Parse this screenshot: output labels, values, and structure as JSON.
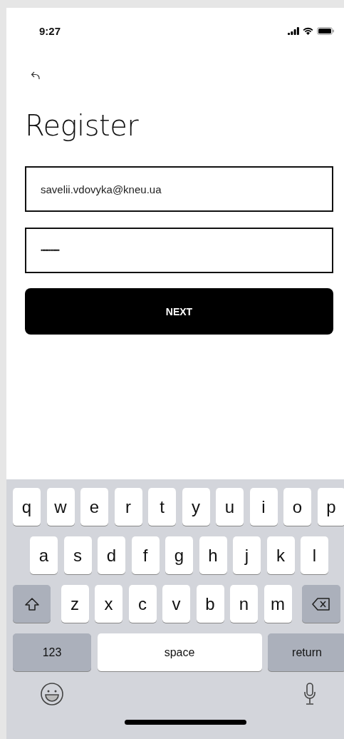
{
  "status_bar": {
    "time": "9:27"
  },
  "title": "Register",
  "fields": [
    {
      "kind": "email",
      "value": "savelii.vdovyka@kneu.ua"
    },
    {
      "kind": "password",
      "value": "••••••••••••"
    }
  ],
  "next_button": {
    "label": "NEXT"
  },
  "keyboard": {
    "key_rows": [
      {
        "keys": [
          {
            "kind": "letter",
            "label": "q"
          },
          {
            "kind": "letter",
            "label": "w"
          },
          {
            "kind": "letter",
            "label": "e"
          },
          {
            "kind": "letter",
            "label": "r"
          },
          {
            "kind": "letter",
            "label": "t"
          },
          {
            "kind": "letter",
            "label": "y"
          },
          {
            "kind": "letter",
            "label": "u"
          },
          {
            "kind": "letter",
            "label": "i"
          },
          {
            "kind": "letter",
            "label": "o"
          },
          {
            "kind": "letter",
            "label": "p"
          }
        ]
      },
      {
        "keys": [
          {
            "kind": "letter",
            "label": "a"
          },
          {
            "kind": "letter",
            "label": "s"
          },
          {
            "kind": "letter",
            "label": "d"
          },
          {
            "kind": "letter",
            "label": "f"
          },
          {
            "kind": "letter",
            "label": "g"
          },
          {
            "kind": "letter",
            "label": "h"
          },
          {
            "kind": "letter",
            "label": "j"
          },
          {
            "kind": "letter",
            "label": "k"
          },
          {
            "kind": "letter",
            "label": "l"
          }
        ]
      },
      {
        "keys": [
          {
            "kind": "shift"
          },
          {
            "kind": "letter",
            "label": "z"
          },
          {
            "kind": "letter",
            "label": "x"
          },
          {
            "kind": "letter",
            "label": "c"
          },
          {
            "kind": "letter",
            "label": "v"
          },
          {
            "kind": "letter",
            "label": "b"
          },
          {
            "kind": "letter",
            "label": "n"
          },
          {
            "kind": "letter",
            "label": "m"
          },
          {
            "kind": "delete"
          }
        ]
      },
      {
        "keys": [
          {
            "kind": "mode",
            "label": "123"
          },
          {
            "kind": "space",
            "label": "space"
          },
          {
            "kind": "return",
            "label": "return"
          }
        ]
      }
    ]
  }
}
